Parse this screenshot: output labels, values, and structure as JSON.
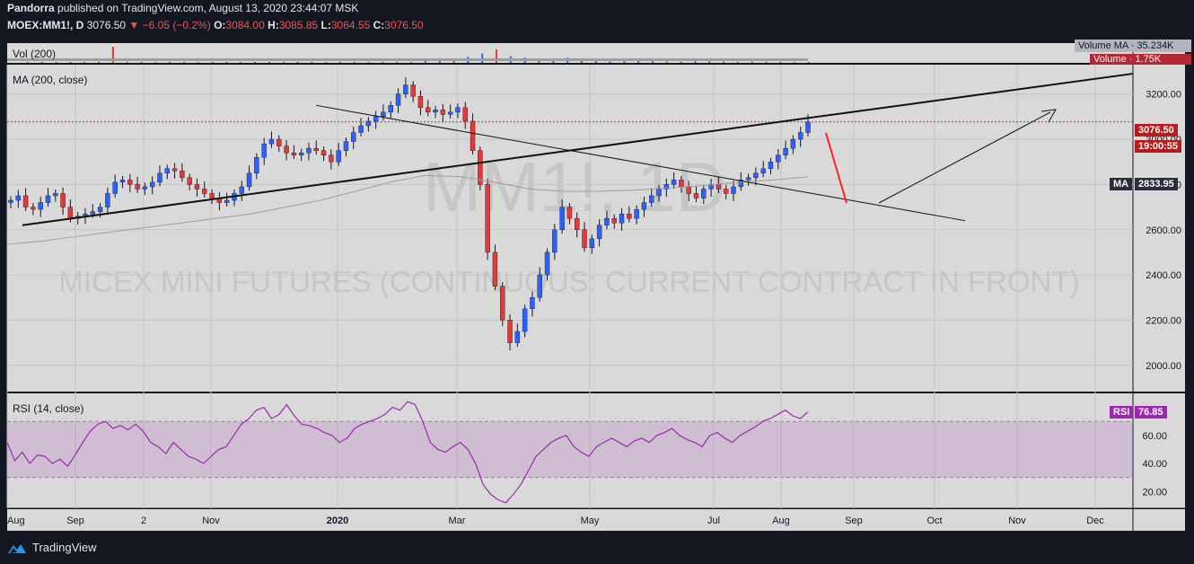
{
  "header": {
    "line1_author": "Pandorra",
    "line1_rest": "published on TradingView.com, August 13, 2020 23:44:07 MSK",
    "symbol": "MOEX:MM1!, D",
    "last": "3076.50",
    "change": "−6.05 (−0.2%)",
    "o_label": "O:",
    "o_value": "3084.00",
    "h_label": "H:",
    "h_value": "3085.85",
    "l_label": "L:",
    "l_value": "3064.55",
    "c_label": "C:",
    "c_value": "3076.50"
  },
  "panes": {
    "volume_title": "Vol (200)",
    "volume_ma_tag": "Volume MA · 35.234K",
    "volume_tag": "Volume · 1.75K",
    "price_title": "MA (200, close)",
    "watermark": "MM1!, 1D",
    "watermark_sub": "MICEX MINI FUTURES (CONTINUOUS: CURRENT CONTRACT IN FRONT)",
    "rsi_title": "RSI (14, close)",
    "price_tag": "3076.50",
    "countdown_tag": "19:00:55",
    "ma_tag_label": "MA",
    "ma_tag_value": "2833.95",
    "rsi_tag_label": "RSI",
    "rsi_tag_value": "76.85"
  },
  "footer": {
    "brand": "TradingView"
  },
  "colors": {
    "up": "#2962ff",
    "down": "#e53935",
    "rsi": "#9c27b0",
    "background": "#131722",
    "pane": "#d9d9d9"
  },
  "chart_data": [
    {
      "type": "candlestick",
      "title": "MOEX:MM1!, D",
      "x_ticks": [
        "Aug",
        "Sep",
        "2",
        "Nov",
        "2020",
        "Mar",
        "May",
        "Jul",
        "Aug",
        "Sep",
        "Oct",
        "Nov",
        "Dec"
      ],
      "y_ticks": [
        "2000.00",
        "2200.00",
        "2400.00",
        "2600.00",
        "2800.00",
        "3000.00",
        "3200.00"
      ],
      "ylim": [
        1880,
        3330
      ],
      "close": [
        2730,
        2750,
        2700,
        2690,
        2720,
        2750,
        2760,
        2700,
        2650,
        2660,
        2670,
        2680,
        2700,
        2760,
        2810,
        2820,
        2800,
        2780,
        2790,
        2810,
        2850,
        2870,
        2860,
        2830,
        2800,
        2780,
        2760,
        2740,
        2720,
        2730,
        2760,
        2790,
        2850,
        2920,
        2980,
        3000,
        2970,
        2940,
        2930,
        2940,
        2960,
        2950,
        2930,
        2900,
        2950,
        2990,
        3030,
        3060,
        3080,
        3100,
        3120,
        3150,
        3200,
        3240,
        3190,
        3140,
        3120,
        3130,
        3110,
        3120,
        3140,
        3080,
        2950,
        2800,
        2500,
        2350,
        2200,
        2100,
        2150,
        2250,
        2300,
        2400,
        2500,
        2600,
        2700,
        2650,
        2600,
        2520,
        2560,
        2620,
        2650,
        2630,
        2670,
        2650,
        2690,
        2720,
        2750,
        2780,
        2800,
        2820,
        2790,
        2760,
        2740,
        2780,
        2800,
        2780,
        2760,
        2790,
        2820,
        2830,
        2850,
        2870,
        2900,
        2930,
        2960,
        3000,
        3030,
        3076.5
      ],
      "ma": {
        "name": "MA",
        "values": [
          2535,
          2550,
          2570,
          2590,
          2610,
          2630,
          2650,
          2670,
          2700,
          2730,
          2770,
          2810,
          2840,
          2835,
          2810,
          2780,
          2770,
          2770,
          2775,
          2785,
          2795,
          2810,
          2820,
          2833.95
        ]
      },
      "trendlines": [
        {
          "name": "rising support",
          "from": [
            "2019-08",
            2620
          ],
          "to": [
            "2020-12",
            3290
          ]
        },
        {
          "name": "falling",
          "from": [
            "2019-12",
            3150
          ],
          "to": [
            "2020-10",
            2640
          ]
        }
      ],
      "volume": {
        "name": "Vol (200)",
        "values": [
          3,
          2,
          2,
          3,
          2,
          2,
          95,
          3,
          2,
          2,
          3,
          2,
          2,
          2,
          3,
          2,
          2,
          2,
          3,
          3,
          2,
          2,
          3,
          2,
          3,
          4,
          3,
          3,
          12,
          20,
          25,
          35,
          55,
          80,
          40,
          30,
          18,
          22,
          30,
          15,
          10,
          8,
          10,
          12,
          9,
          8,
          7,
          10,
          9,
          7,
          6,
          8,
          6,
          5,
          4,
          6
        ]
      }
    },
    {
      "type": "line",
      "title": "RSI (14, close)",
      "y_ticks": [
        "20.00",
        "40.00",
        "60.00"
      ],
      "ylim": [
        8,
        90
      ],
      "band": [
        30,
        70
      ],
      "values": [
        55,
        42,
        48,
        40,
        46,
        45,
        40,
        43,
        38,
        46,
        55,
        63,
        68,
        70,
        65,
        67,
        64,
        68,
        63,
        55,
        52,
        47,
        55,
        50,
        45,
        43,
        40,
        45,
        50,
        52,
        60,
        68,
        72,
        78,
        80,
        72,
        75,
        82,
        74,
        68,
        67,
        65,
        62,
        60,
        55,
        58,
        65,
        68,
        70,
        72,
        75,
        80,
        78,
        84,
        82,
        70,
        55,
        50,
        48,
        52,
        55,
        50,
        40,
        25,
        18,
        14,
        12,
        18,
        25,
        35,
        45,
        50,
        55,
        58,
        60,
        52,
        48,
        45,
        52,
        55,
        58,
        55,
        52,
        56,
        58,
        55,
        60,
        62,
        65,
        60,
        57,
        55,
        52,
        60,
        62,
        58,
        55,
        60,
        63,
        66,
        70,
        72,
        75,
        78,
        74,
        72,
        76.85
      ]
    }
  ]
}
